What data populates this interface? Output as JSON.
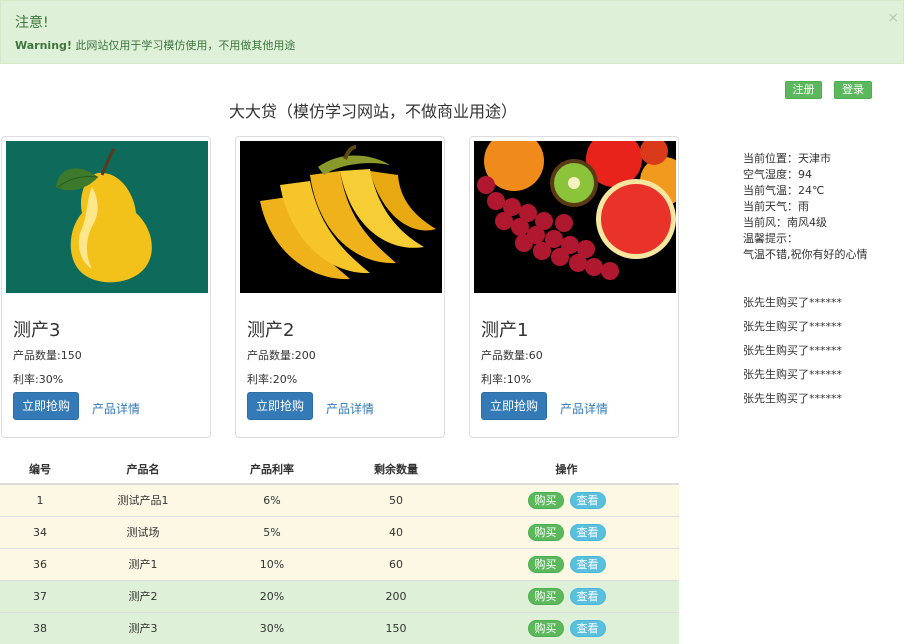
{
  "alert": {
    "title": "注意!",
    "strong": "Warning!",
    "message": " 此网站仅用于学习模仿使用，不用做其他用途",
    "close": "×"
  },
  "auth": {
    "register": "注册",
    "login": "登录"
  },
  "site_title": "大大贷（模仿学习网站，不做商业用途）",
  "products": [
    {
      "name": "测产3",
      "qty": "产品数量:150",
      "rate": "利率:30%",
      "buy": "立即抢购",
      "detail": "产品详情",
      "image": "pear"
    },
    {
      "name": "测产2",
      "qty": "产品数量:200",
      "rate": "利率:20%",
      "buy": "立即抢购",
      "detail": "产品详情",
      "image": "banana"
    },
    {
      "name": "测产1",
      "qty": "产品数量:60",
      "rate": "利率:10%",
      "buy": "立即抢购",
      "detail": "产品详情",
      "image": "mixed-fruit"
    }
  ],
  "weather": {
    "location": "当前位置：天津市",
    "humidity": "空气湿度：94",
    "temp": "当前气温：24℃",
    "sky": "当前天气：雨",
    "wind": "当前风：南风4级",
    "tip_label": "温馨提示：",
    "tip": "气温不错,祝你有好的心情"
  },
  "purchases": [
    "张先生购买了******",
    "张先生购买了******",
    "张先生购买了******",
    "张先生购买了******",
    "张先生购买了******"
  ],
  "table": {
    "headers": [
      "编号",
      "产品名",
      "产品利率",
      "剩余数量",
      "操作"
    ],
    "buy_label": "购买",
    "view_label": "查看",
    "rows": [
      {
        "id": "1",
        "name": "测试产品1",
        "rate": "6%",
        "remain": "50",
        "style": "warning"
      },
      {
        "id": "34",
        "name": "测试场",
        "rate": "5%",
        "remain": "40",
        "style": "warning"
      },
      {
        "id": "36",
        "name": "测产1",
        "rate": "10%",
        "remain": "60",
        "style": "warning"
      },
      {
        "id": "37",
        "name": "测产2",
        "rate": "20%",
        "remain": "200",
        "style": "success"
      },
      {
        "id": "38",
        "name": "测产3",
        "rate": "30%",
        "remain": "150",
        "style": "success"
      }
    ]
  },
  "colors": {
    "primary": "#337ab7",
    "success": "#5cb85c",
    "info": "#5bc0de",
    "alert_bg": "#dff0d8",
    "alert_text": "#3c763d"
  }
}
